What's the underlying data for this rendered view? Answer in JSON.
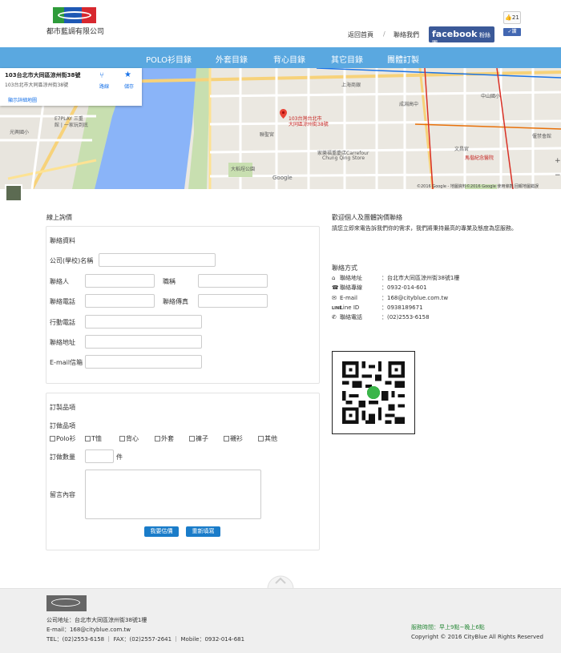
{
  "header": {
    "company_name": "都市藍調有限公司",
    "like_count": "21",
    "nav_home": "返回首頁",
    "nav_sep": "/",
    "nav_contact": "聯絡我們",
    "facebook_word": "facebook",
    "facebook_sub": "粉絲團"
  },
  "navbar": {
    "items": [
      "POLO衫目錄",
      "外套目錄",
      "背心目錄",
      "其它目錄",
      "團體訂製"
    ]
  },
  "map": {
    "card_address": "103台北市大同區涼州街38號",
    "card_sub": "103台北市大同區涼州街38號",
    "directions_label": "路線",
    "save_label": "儲存",
    "details_link": "顯示詳細地圖",
    "pin_label_1": "103台灣台北市",
    "pin_label_2": "大同區涼州街38號",
    "labels": {
      "e7play": "E7PLAY 三重",
      "e7play_sub": "館 | 一家玩到底",
      "guangxing": "光興國小",
      "liansheng": "聯聖宮",
      "dalongdong": "大稻埕公園",
      "carrefour1": "家樂福重慶店Carrefour",
      "carrefour2": "Chung Qing Store",
      "chengyuan": "成淵高中",
      "wenchang": "文昌宮",
      "maxie": "馬偕紀念醫院",
      "shanghai": "上海商銀",
      "mengjia": "中山國小",
      "xibi": "偃禁會館"
    },
    "google": "Google",
    "copyright": "©2016 Google - 地圖資料©2016 Google   使用條款   回報地圖錯誤"
  },
  "form": {
    "online_title": "線上詢價",
    "section1_title": "聯絡資料",
    "company_label": "公司(學校)名稱",
    "contact_label": "聯絡人",
    "title_label": "職稱",
    "phone_label": "聯絡電話",
    "fax_label": "聯絡傳真",
    "mobile_label": "行動電話",
    "address_label": "聯絡地址",
    "email_label": "E-mail信箱",
    "section2_title": "訂製品項",
    "items_label": "訂做品項",
    "items": [
      "Polo衫",
      "T恤",
      "背心",
      "外套",
      "褲子",
      "襯衫",
      "其他"
    ],
    "qty_label": "訂做數量",
    "qty_unit": "件",
    "message_label": "留言內容",
    "submit_label": "我要估價",
    "reset_label": "重新填寫"
  },
  "right": {
    "welcome": "歡迎個人及團體詢價聯絡",
    "welcome_desc": "請您立即來電告訴我們你的需求，我們將秉持最高的專業及態度為您服務。",
    "contact_title": "聯絡方式",
    "rows": [
      {
        "label": "聯絡地址",
        "value": "：台北市大同區涼州街38號1樓"
      },
      {
        "label": "聯絡專線",
        "value": "：0932-014-601"
      },
      {
        "label": "E-mail",
        "value": "：168@cityblue.com.tw"
      },
      {
        "label": "Line ID",
        "value": "：0938189671"
      },
      {
        "label": "聯絡電話",
        "value": "：(02)2553-6158"
      }
    ]
  },
  "footer": {
    "address": "公司地址：台北市大同區涼州街38號1樓",
    "email": "E-mail：168@cityblue.com.tw",
    "phones": "TEL：(02)2553-6158 ｜ FAX：(02)2557-2641 ｜ Mobile：0932-014-681",
    "hours": "服務時間：早上9點~晚上6點",
    "copyright": "Copyright © 2016 CityBlue All Rights Reserved"
  },
  "colors": {
    "navbar": "#5aa8e0",
    "facebook": "#3b5998",
    "button": "#1a7cc9",
    "hours_green": "#2e8b3d"
  }
}
